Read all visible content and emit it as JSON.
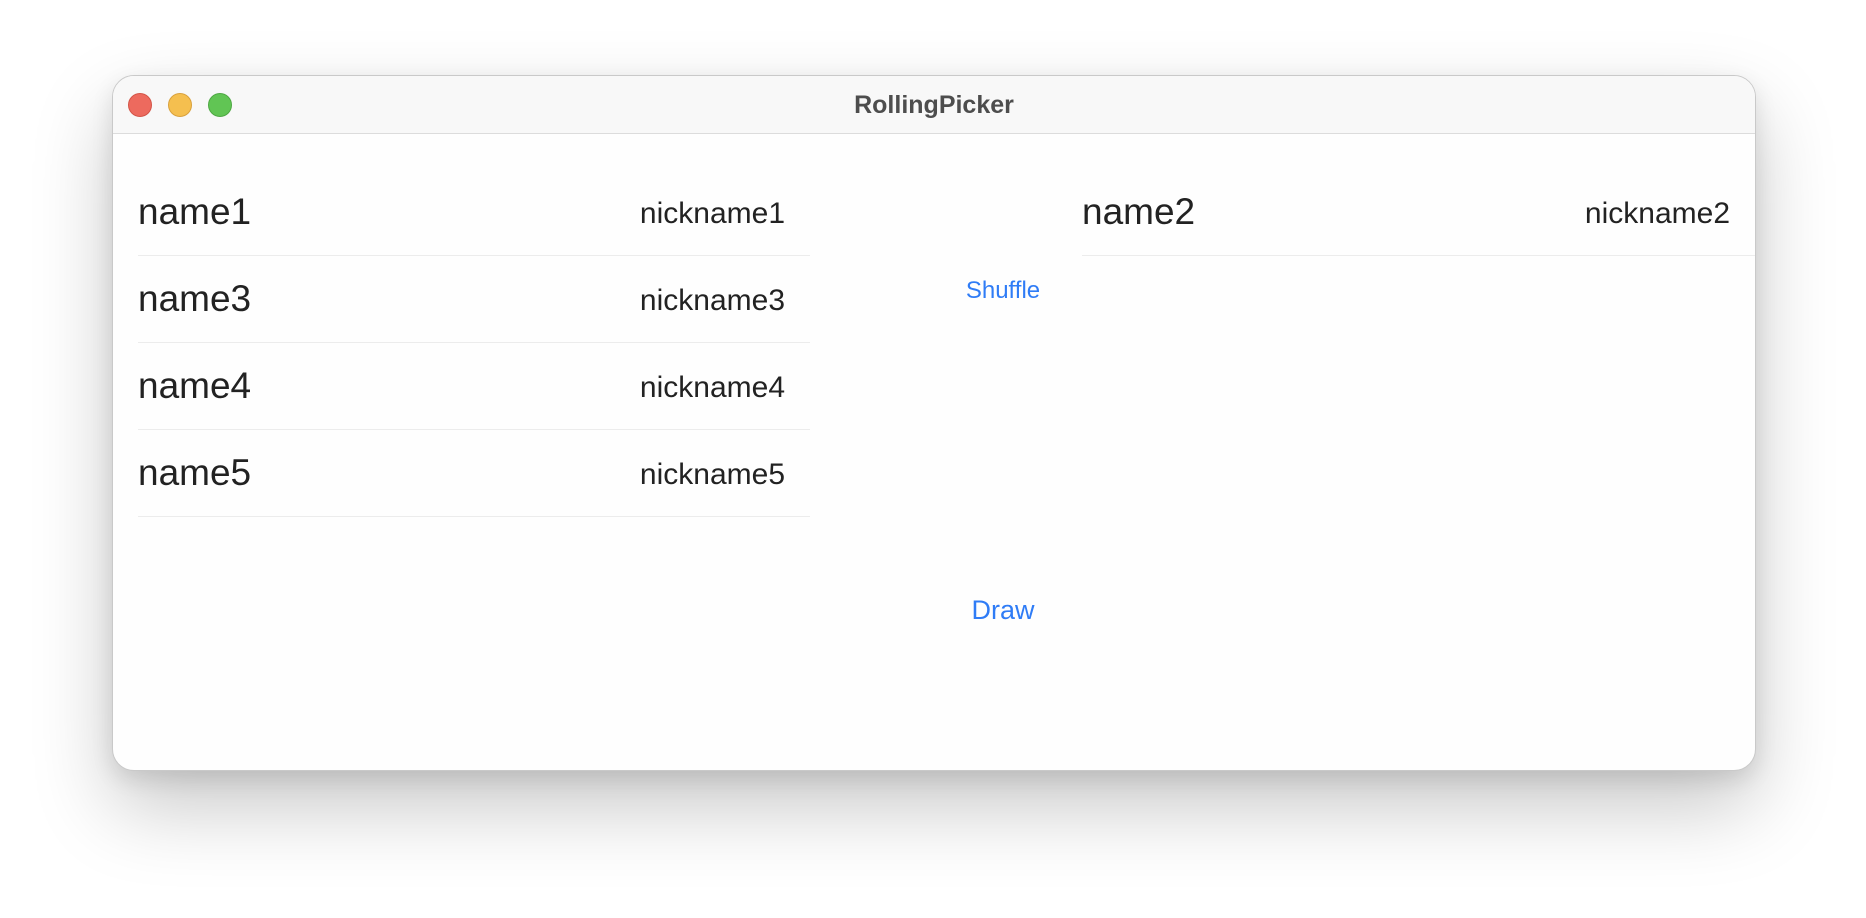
{
  "window": {
    "title": "RollingPicker"
  },
  "left_list": {
    "rows": [
      {
        "name": "name1",
        "nickname": "nickname1"
      },
      {
        "name": "name3",
        "nickname": "nickname3"
      },
      {
        "name": "name4",
        "nickname": "nickname4"
      },
      {
        "name": "name5",
        "nickname": "nickname5"
      }
    ]
  },
  "right_list": {
    "rows": [
      {
        "name": "name2",
        "nickname": "nickname2"
      }
    ]
  },
  "actions": {
    "shuffle_label": "Shuffle",
    "draw_label": "Draw"
  },
  "colors": {
    "accent": "#2f7cf6",
    "traffic_close": "#ed6a5e",
    "traffic_minimize": "#f5bf4f",
    "traffic_zoom": "#61c554"
  }
}
